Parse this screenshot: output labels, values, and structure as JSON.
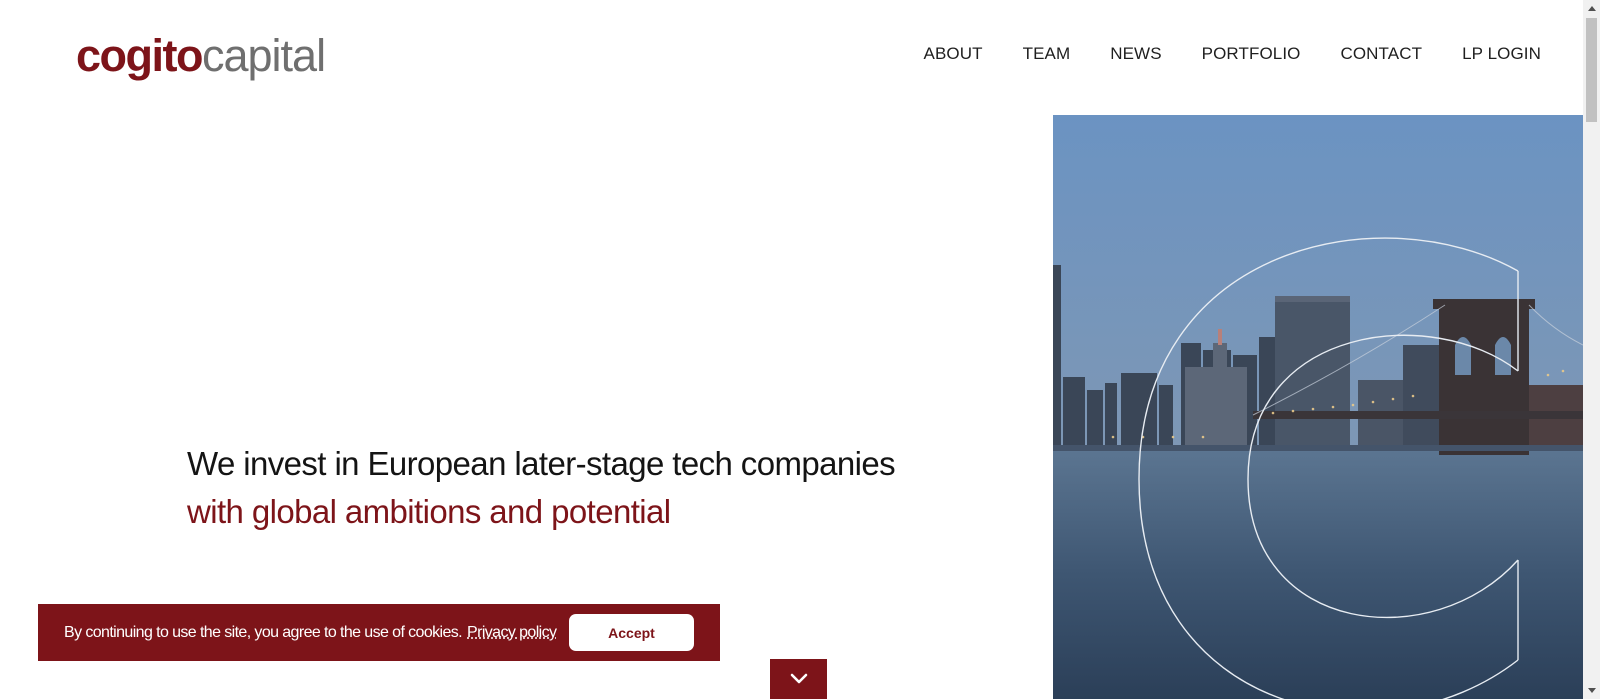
{
  "brand": {
    "logo_part1": "cogito",
    "logo_part2": "capital",
    "color_primary": "#7d1419",
    "color_grey": "#6f6f6f"
  },
  "nav": {
    "items": [
      {
        "label": "ABOUT"
      },
      {
        "label": "TEAM"
      },
      {
        "label": "NEWS"
      },
      {
        "label": "PORTFOLIO"
      },
      {
        "label": "CONTACT"
      },
      {
        "label": "LP LOGIN"
      }
    ]
  },
  "hero": {
    "line1": "We invest in European later-stage tech companies",
    "line2": "with global ambitions and potential",
    "image_icon": "city-bridge-photo"
  },
  "cookie": {
    "text": "By continuing to use the site, you agree to the use of cookies.",
    "link": "Privacy policy",
    "accept": "Accept"
  },
  "scroll_down": {
    "icon": "chevron-down-icon"
  }
}
